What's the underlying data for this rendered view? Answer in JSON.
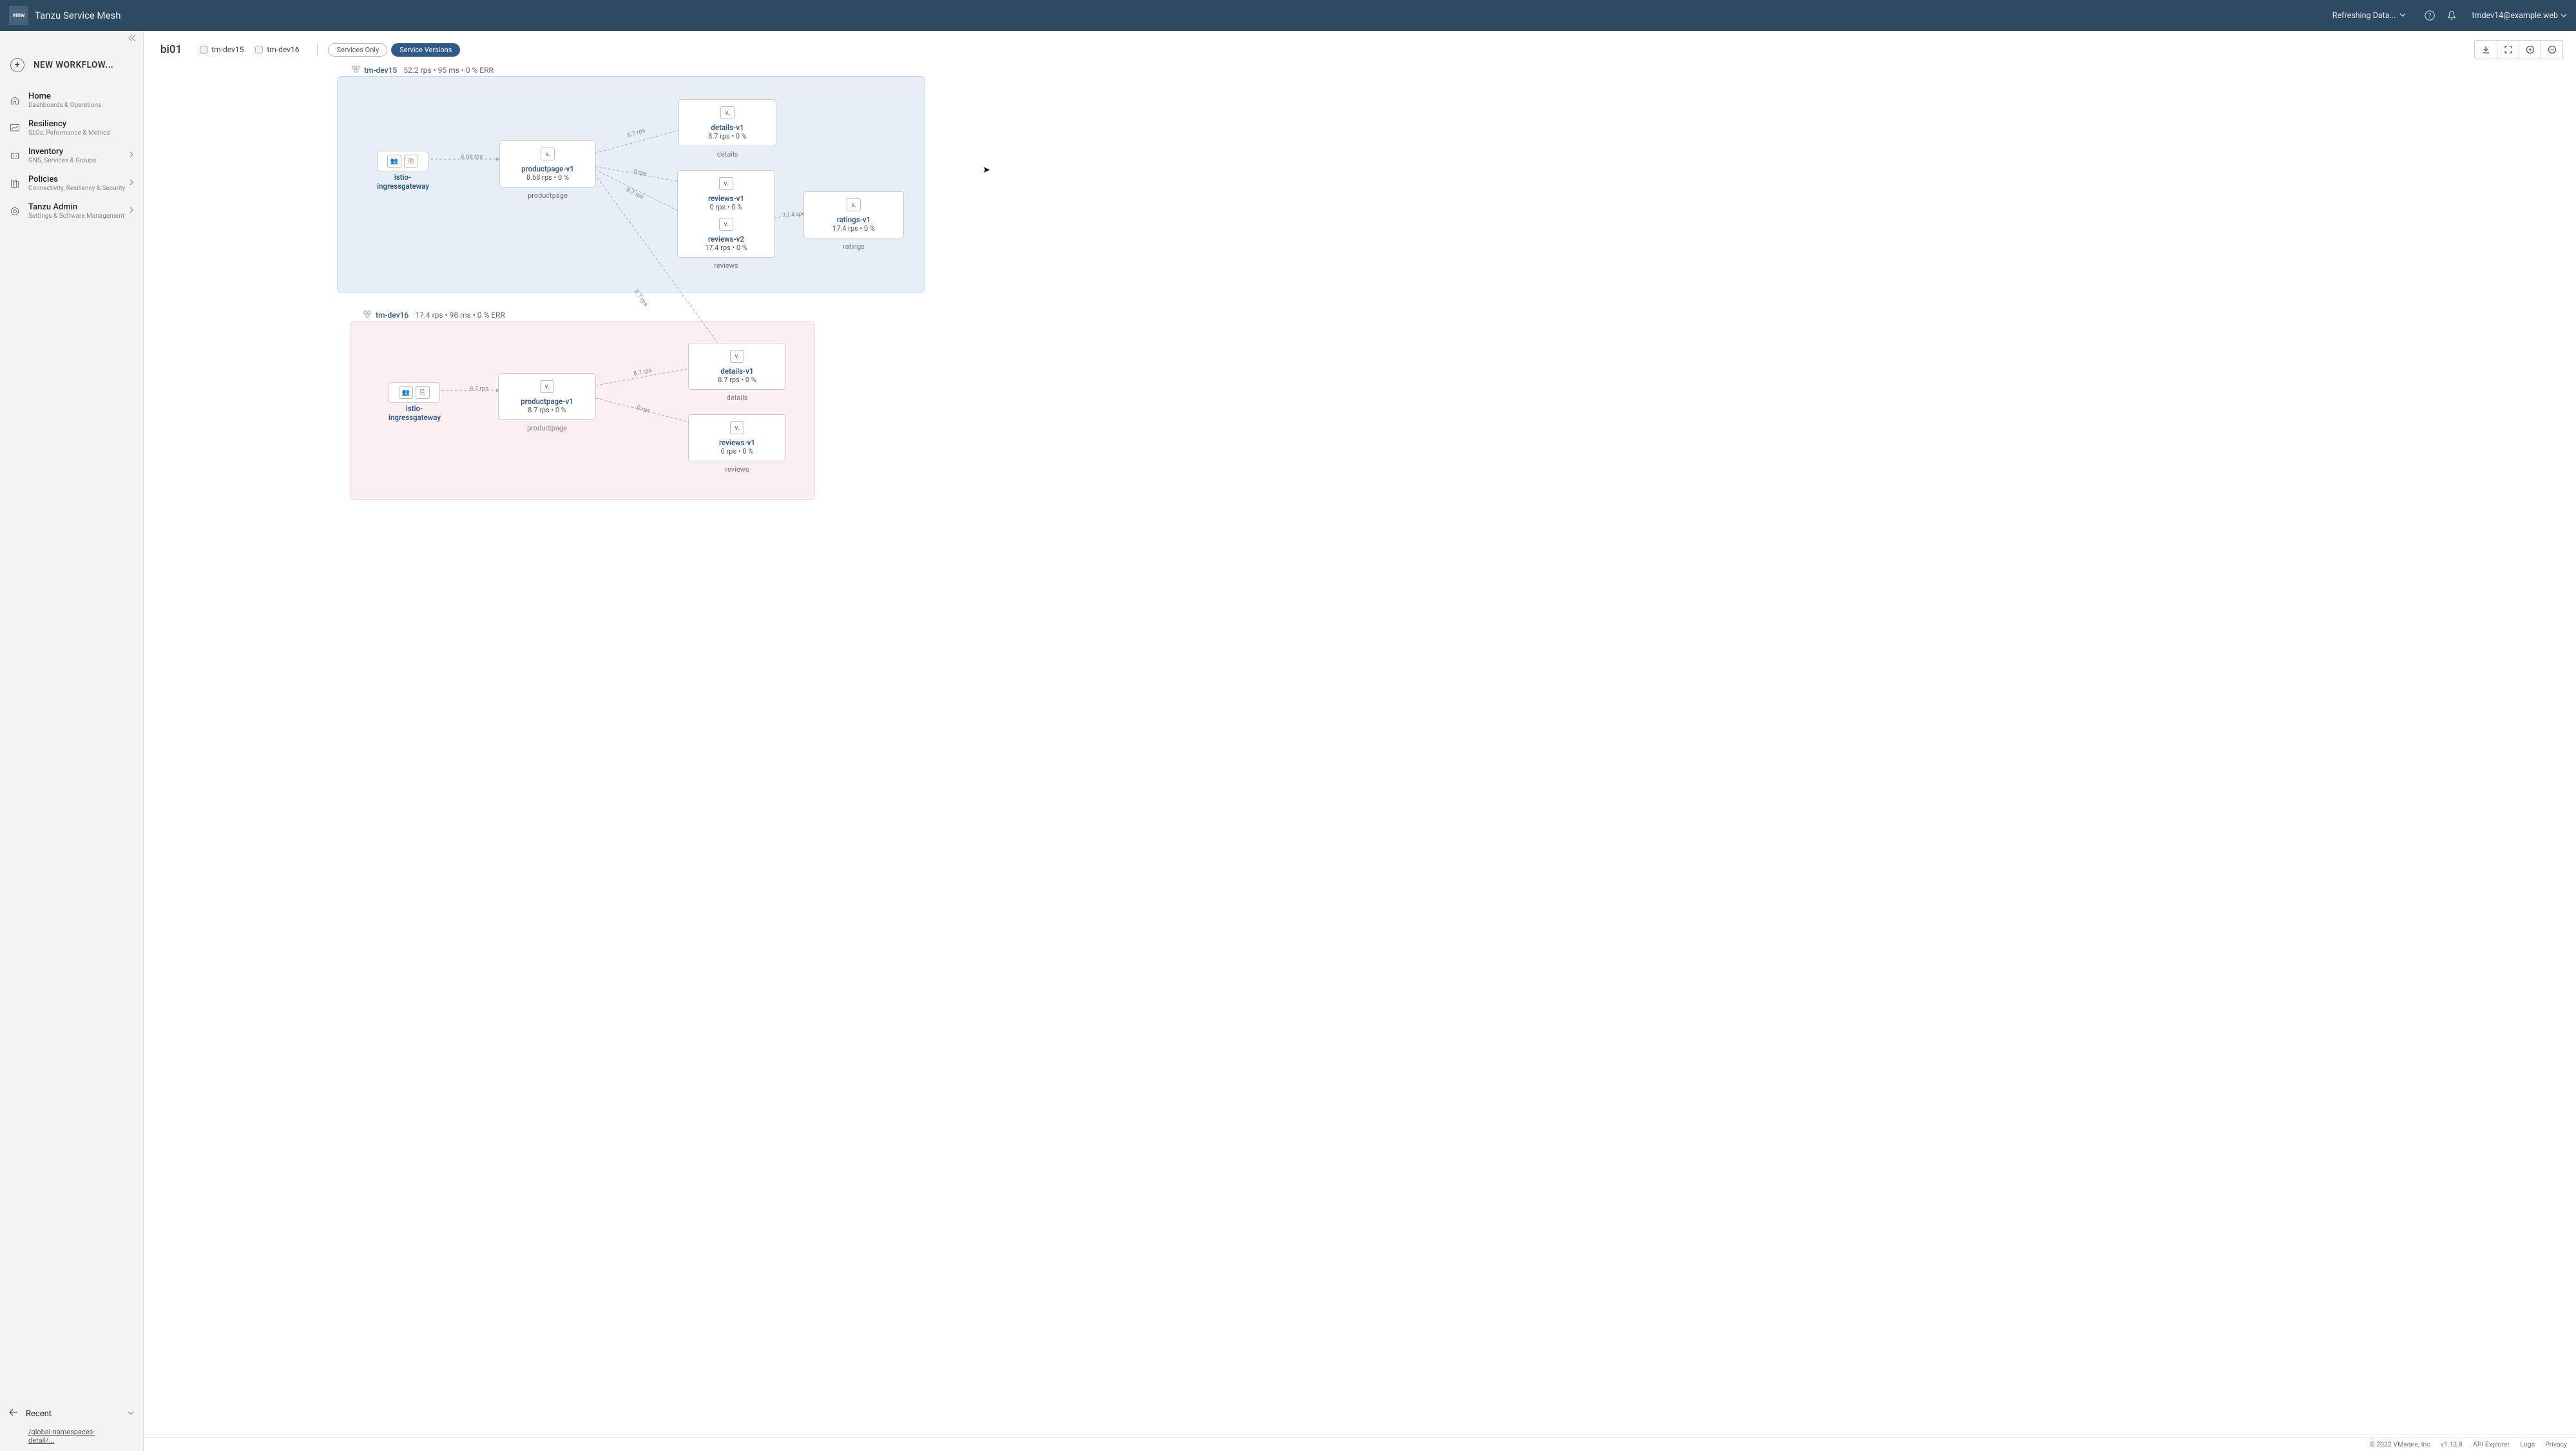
{
  "header": {
    "logo_text": "vmw",
    "app_name": "Tanzu Service Mesh",
    "status_text": "Refreshing Data...",
    "user": "tmdev14@example.web"
  },
  "sidebar": {
    "new_workflow": "NEW WORKFLOW...",
    "items": [
      {
        "label": "Home",
        "sub": "Dashboards & Operations",
        "caret": false
      },
      {
        "label": "Resiliency",
        "sub": "SLOs, Peformance & Metrics",
        "caret": false
      },
      {
        "label": "Inventory",
        "sub": "GNS, Services & Groups",
        "caret": true
      },
      {
        "label": "Policies",
        "sub": "Connectivity, Resiliency & Security",
        "caret": true
      },
      {
        "label": "Tanzu Admin",
        "sub": "Settings & Software Management",
        "caret": true
      }
    ],
    "recent_label": "Recent",
    "recent_link": "/global-namespaces-detail/..."
  },
  "toolbar": {
    "title": "bi01",
    "legend": {
      "blue": "tm-dev15",
      "pink": "tm-dev16"
    },
    "pill_outline": "Services Only",
    "pill_filled": "Service Versions"
  },
  "clusters": {
    "c1": {
      "name": "tm-dev15",
      "stats": "52.2 rps • 95 ms • 0 % ERR"
    },
    "c2": {
      "name": "tm-dev16",
      "stats": "17.4 rps • 98 ms • 0 % ERR"
    }
  },
  "nodes": {
    "c1_ingress": {
      "name": "istio-ingressgateway",
      "stats": ""
    },
    "c1_productpage": {
      "name": "productpage-v1",
      "stats": "8.68 rps • 0 %",
      "group": "productpage"
    },
    "c1_details": {
      "name": "details-v1",
      "stats": "8.7 rps • 0 %",
      "group": "details"
    },
    "c1_reviews_v1": {
      "name": "reviews-v1",
      "stats": "0 rps • 0 %"
    },
    "c1_reviews_v2": {
      "name": "reviews-v2",
      "stats": "17.4 rps • 0 %",
      "group": "reviews"
    },
    "c1_ratings": {
      "name": "ratings-v1",
      "stats": "17.4 rps • 0 %",
      "group": "ratings"
    },
    "c2_ingress": {
      "name": "istio-ingressgateway",
      "stats": ""
    },
    "c2_productpage": {
      "name": "productpage-v1",
      "stats": "8.7 rps • 0 %",
      "group": "productpage"
    },
    "c2_details": {
      "name": "details-v1",
      "stats": "8.7 rps • 0 %",
      "group": "details"
    },
    "c2_reviews": {
      "name": "reviews-v1",
      "stats": "0 rps • 0 %",
      "group": "reviews"
    }
  },
  "edges": {
    "e_c1_ing_pp": "8.68  rps",
    "e_c1_pp_det": "8.7  rps",
    "e_c1_pp_rev": "0  rps",
    "e_c1_pp_rev2": "8.7  rps",
    "e_c1_rev_rat": "17.4  rps",
    "e_cross": "8.7  rps",
    "e_c2_ing_pp": "8.7  rps",
    "e_c2_pp_det": "8.7  rps",
    "e_c2_pp_rev": "0  rps"
  },
  "footer": {
    "copyright": "© 2022 VMware, Inc",
    "version": "v1.13.8",
    "api": "API Explorer",
    "logs": "Logs",
    "privacy": "Privacy"
  }
}
